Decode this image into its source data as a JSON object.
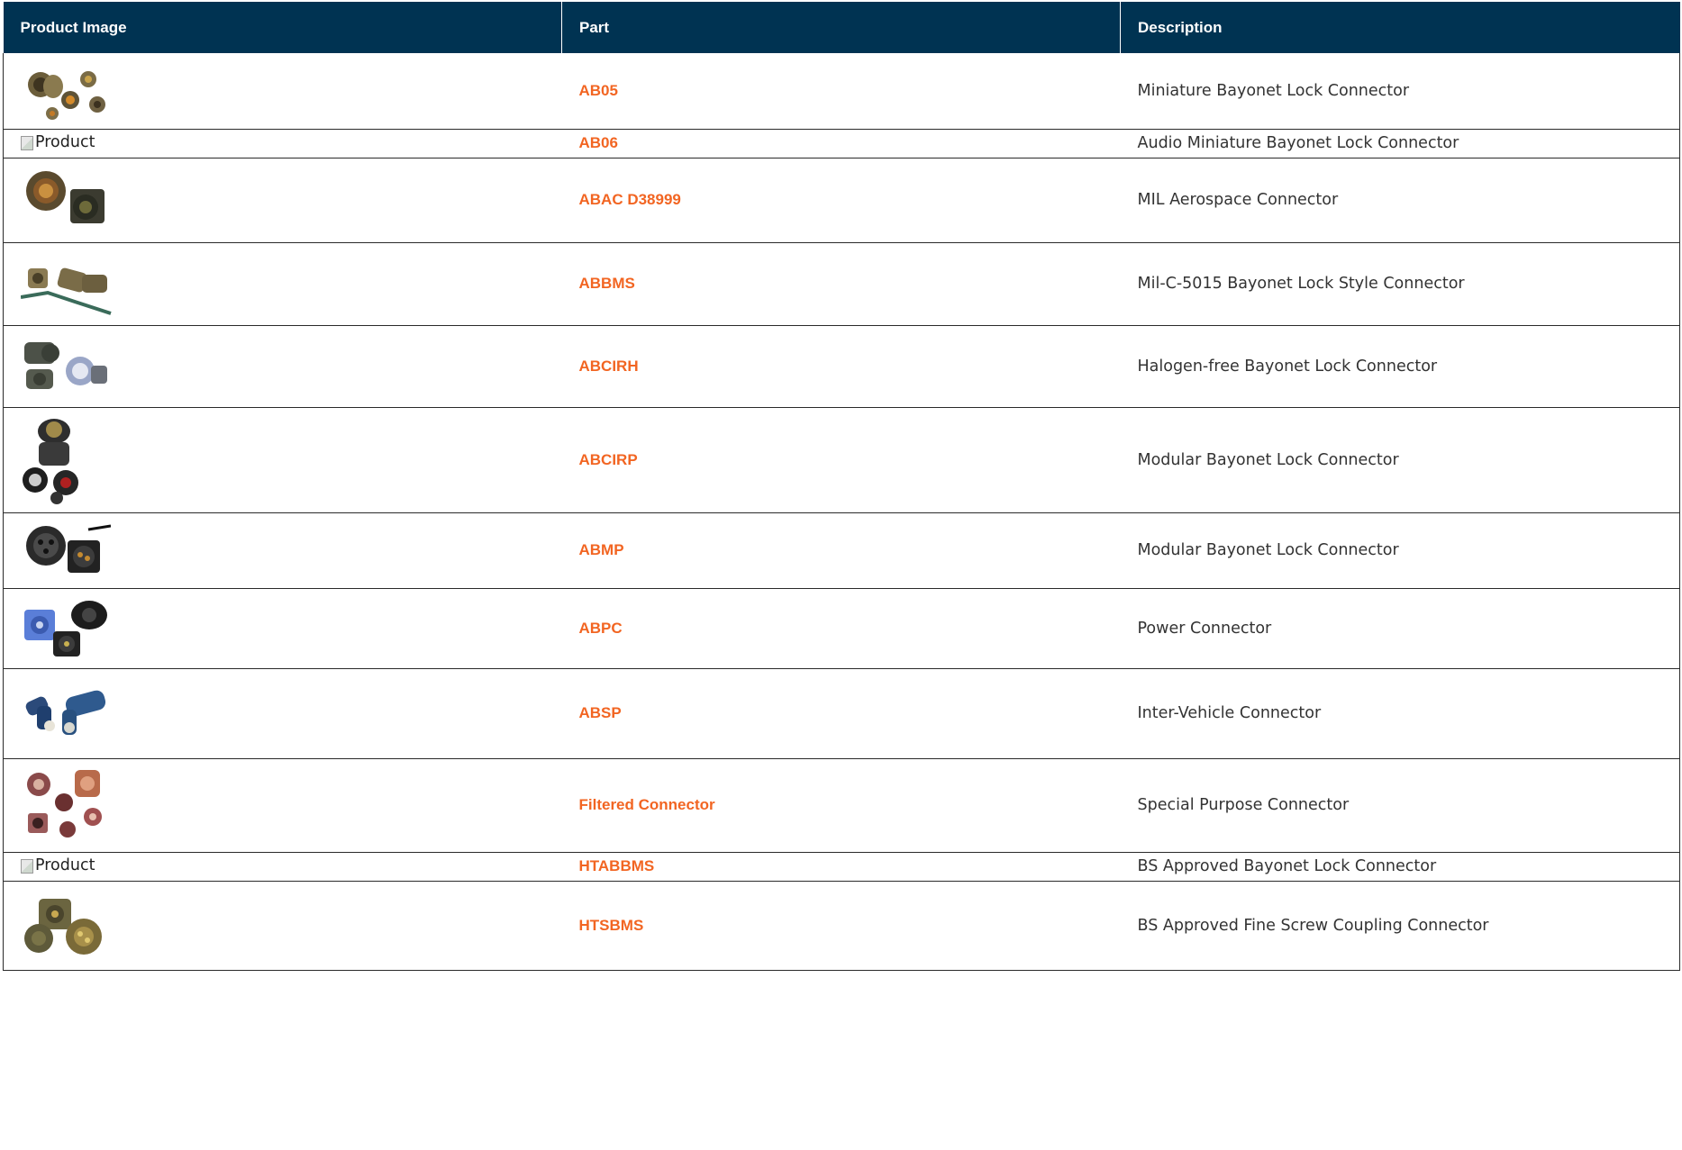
{
  "table": {
    "headers": [
      "Product Image",
      "Part",
      "Description"
    ],
    "rows": [
      {
        "image": "connector-cluster-olive",
        "part": "AB05",
        "description": "Miniature Bayonet Lock Connector"
      },
      {
        "image": "broken",
        "image_alt": "Product",
        "part": "AB06",
        "description": "Audio Miniature Bayonet Lock Connector"
      },
      {
        "image": "connector-pair-bronze",
        "part": "ABAC D38999",
        "description": "MIL Aerospace Connector"
      },
      {
        "image": "connector-elbow-cable",
        "part": "ABBMS",
        "description": "Mil-C-5015 Bayonet Lock Style Connector"
      },
      {
        "image": "connector-gray-blue",
        "part": "ABCIRH",
        "description": "Halogen-free Bayonet Lock Connector"
      },
      {
        "image": "connector-stack-black",
        "part": "ABCIRP",
        "description": "Modular Bayonet Lock Connector"
      },
      {
        "image": "connector-black-cable",
        "part": "ABMP",
        "description": "Modular Bayonet Lock Connector"
      },
      {
        "image": "connector-blue-black",
        "part": "ABPC",
        "description": "Power Connector"
      },
      {
        "image": "connector-navy-elbow",
        "part": "ABSP",
        "description": "Inter-Vehicle Connector"
      },
      {
        "image": "connector-copper-cluster",
        "part": "Filtered Connector",
        "description": "Special Purpose Connector"
      },
      {
        "image": "broken",
        "image_alt": "Product",
        "part": "HTABBMS",
        "description": "BS Approved Bayonet Lock Connector"
      },
      {
        "image": "connector-olive-trio",
        "part": "HTSBMS",
        "description": "BS Approved Fine Screw Coupling Connector"
      }
    ]
  },
  "colors": {
    "header_bg": "#003352",
    "link": "#f26522",
    "text": "#333333"
  }
}
